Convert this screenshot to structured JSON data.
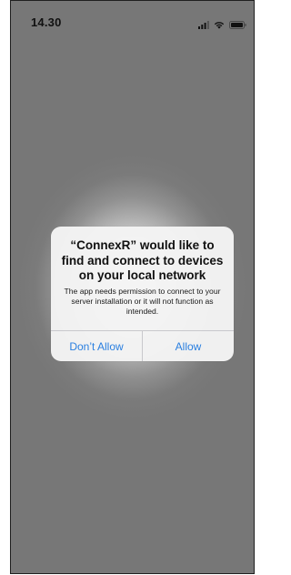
{
  "status_bar": {
    "time": "14.30",
    "icons": [
      "signal-icon",
      "wifi-icon",
      "battery-icon"
    ]
  },
  "alert": {
    "title": "“ConnexR” would like to find and connect to devices on your local network",
    "message": "The app needs permission to connect to your server installation or it will not function as intended.",
    "buttons": {
      "deny": "Don’t Allow",
      "allow": "Allow"
    }
  },
  "colors": {
    "accent": "#2a7fe0",
    "backdrop": "#7b7b7b",
    "alert_background": "#f4f4f4"
  }
}
